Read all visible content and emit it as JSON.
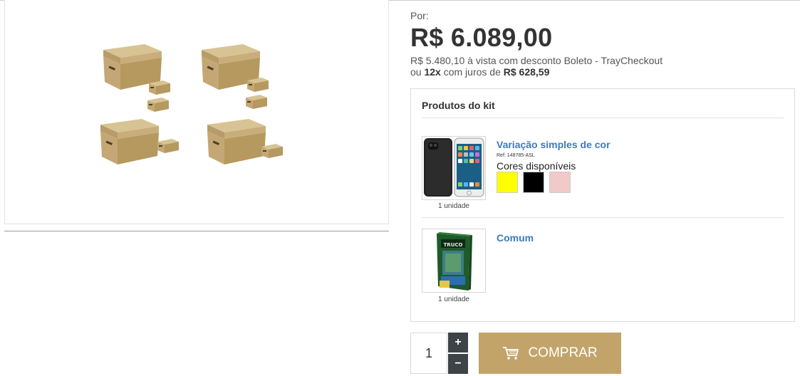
{
  "product": {
    "price_prefix": "Por:",
    "price": "R$ 6.089,00",
    "cash_price": "R$ 5.480,10",
    "cash_text": " à vista com desconto Boleto - TrayCheckout",
    "installments_prefix": "ou ",
    "installments_count": "12x",
    "installments_mid": " com juros de ",
    "installment_value": "R$ 628,59"
  },
  "kit": {
    "title": "Produtos do kit",
    "items": [
      {
        "name": "Variação simples de cor",
        "ref": "Ref: 148785-ASL",
        "colors_label": "Cores disponíveis",
        "colors": [
          "#ffff00",
          "#000000",
          "#f2c9c9"
        ],
        "quantity": "1 unidade",
        "image_icon": "phone-case-image"
      },
      {
        "name": "Comum",
        "quantity": "1 unidade",
        "image_icon": "game-package-image"
      }
    ]
  },
  "purchase": {
    "quantity": "1",
    "plus": "+",
    "minus": "−",
    "buy_label": "COMPRAR",
    "buy_icon": "cart-icon",
    "button_color": "#c2a46a"
  },
  "main_image_icon": "cardboard-boxes-image"
}
